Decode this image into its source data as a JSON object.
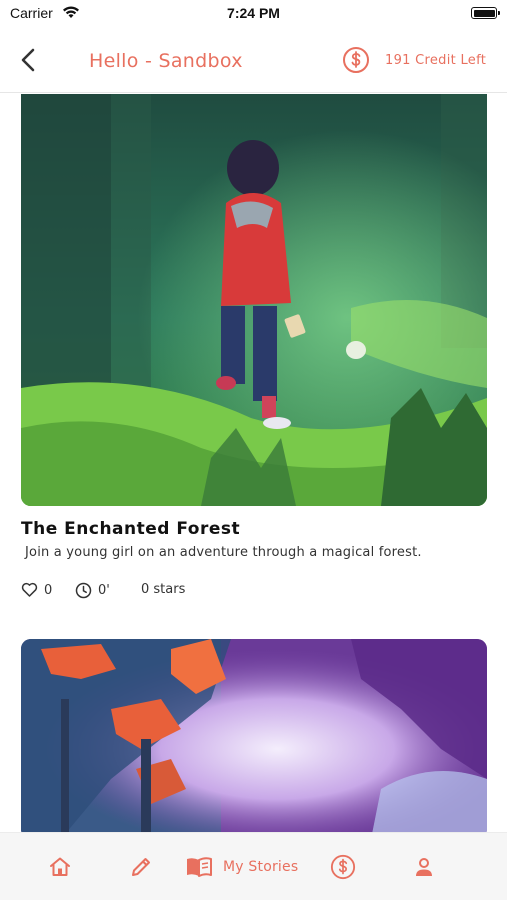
{
  "status_bar": {
    "carrier": "Carrier",
    "time": "7:24 PM"
  },
  "header": {
    "title": "Hello - Sandbox",
    "credits": "191 Credit Left"
  },
  "stories": [
    {
      "title": "The Enchanted Forest",
      "description": "Join a young girl on an adventure through a magical forest.",
      "likes": "0",
      "duration": "0'",
      "stars": "0 stars"
    }
  ],
  "tab_bar": {
    "items": [
      {
        "icon": "home-icon"
      },
      {
        "icon": "pencil-icon"
      },
      {
        "icon": "book-icon",
        "label": "My Stories"
      },
      {
        "icon": "dollar-icon"
      },
      {
        "icon": "person-icon"
      }
    ]
  },
  "colors": {
    "accent": "#e8705f",
    "text": "#111111"
  }
}
